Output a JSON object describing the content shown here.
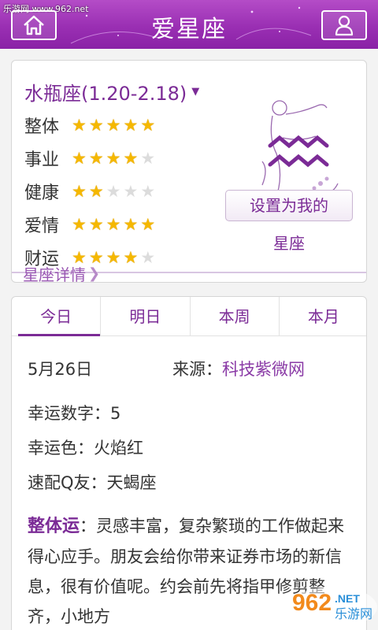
{
  "header": {
    "site_mark": "乐游网 www.962.net",
    "title": "爱星座"
  },
  "zodiac": {
    "sign": "水瓶座(1.20-2.18)",
    "ratings": [
      {
        "label": "整体",
        "stars": 5
      },
      {
        "label": "事业",
        "stars": 4
      },
      {
        "label": "健康",
        "stars": 2
      },
      {
        "label": "爱情",
        "stars": 5
      },
      {
        "label": "财运",
        "stars": 4
      }
    ],
    "max_stars": 5,
    "set_button_line1": "设置为我的",
    "set_button_line2": "星座",
    "details_link": "星座详情"
  },
  "fortune": {
    "tabs": [
      "今日",
      "明日",
      "本周",
      "本月"
    ],
    "active_tab": 0,
    "date": "5月26日",
    "source_label": "来源：",
    "source_value": "科技紫微网",
    "lucky_number": "幸运数字：5",
    "lucky_color": "幸运色：火焰红",
    "match": "速配Q友：天蝎座",
    "overall_head": "整体运",
    "overall_text": "：灵感丰富，复杂繁琐的工作做起来得心应手。朋友会给你带来证券市场的新信息，很有价值呢。约会前先将指甲修剪整齐，小地方"
  },
  "watermark": {
    "brand": "962",
    "suffix": ".NET",
    "name": "乐游网"
  },
  "colors": {
    "accent": "#7b2b96",
    "header": "#9a2fb3",
    "star_on": "#f5b800",
    "star_off": "#dcdcdc"
  },
  "icons": {
    "home": "home-icon",
    "user": "user-icon",
    "dropdown": "caret-down-icon",
    "details": "chevron-right-icon",
    "zodiac": "aquarius-icon"
  }
}
